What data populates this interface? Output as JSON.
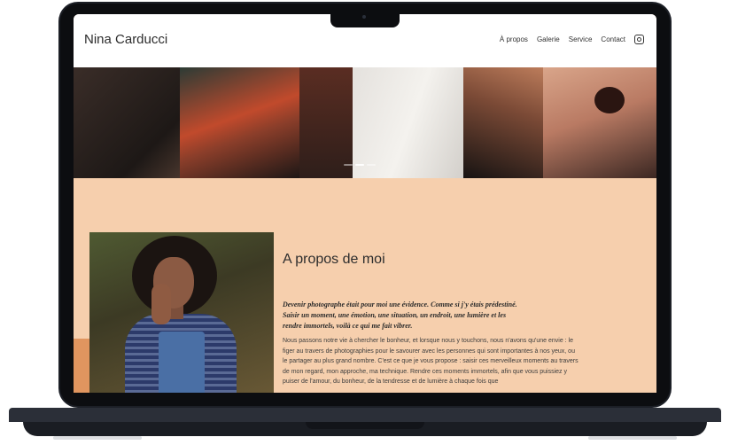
{
  "site": {
    "logo": "Nina Carducci",
    "nav": [
      "À propos",
      "Galerie",
      "Service",
      "Contact"
    ],
    "instagram_icon": "instagram-icon"
  },
  "hero": {
    "carousel_indicators": 3,
    "active_index": 1
  },
  "about": {
    "title": "A propos de moi",
    "lead": "Devenir photographe était pour moi une évidence. Comme si j'y étais prédestiné. Saisir un moment, une émotion, une situation, un endroit, une lumière et les rendre immortels, voilà ce qui me fait vibrer.",
    "body": "Nous passons notre vie à chercher le bonheur, et lorsque nous y touchons, nous n'avons qu'une envie : le figer au travers de photographies pour le savourer avec les personnes qui sont importantes à nos yeux, ou le partager au plus grand nombre. C'est ce que je vous propose : saisir ces merveilleux moments au travers de mon regard, mon approche, ma technique. Rendre ces moments immortels, afin que vous puissiez y puiser de l'amour, du bonheur, de la tendresse et de lumière à chaque fois que"
  },
  "colors": {
    "page_background": "#f6cfad",
    "accent_orange": "#e0955f",
    "device_frame": "#1c1f26"
  }
}
